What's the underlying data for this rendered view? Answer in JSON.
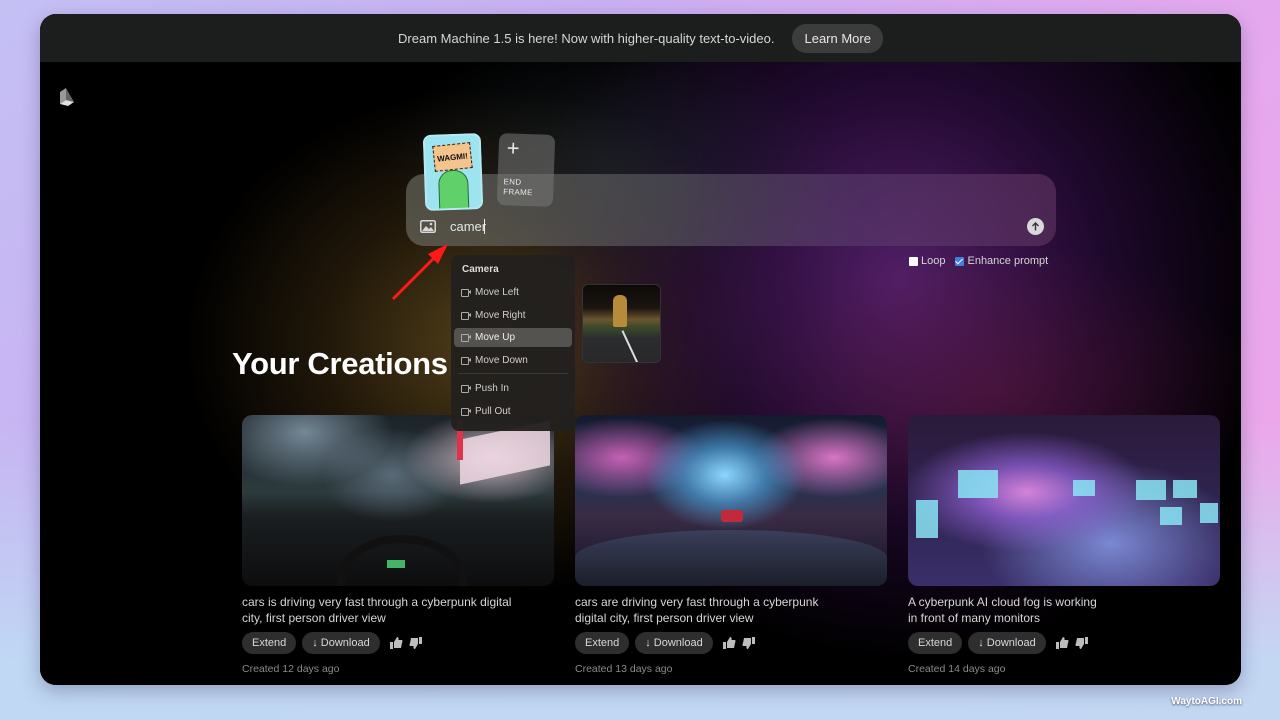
{
  "banner": {
    "message": "Dream Machine 1.5 is here! Now with higher-quality text-to-video.",
    "cta_label": "Learn More"
  },
  "app": {
    "logo_icon": "luma-cube-icon"
  },
  "frames": {
    "start_frame_text": "WAGMI!",
    "end_frame_plus": "+",
    "end_frame_label_line1": "END",
    "end_frame_label_line2": "FRAME"
  },
  "prompt": {
    "value": "camer",
    "image_icon": "image-icon",
    "send_icon": "arrow-up-icon"
  },
  "options": [
    {
      "label": "Loop",
      "checked": false
    },
    {
      "label": "Enhance prompt",
      "checked": true
    }
  ],
  "dropdown": {
    "header": "Camera",
    "items": [
      {
        "label": "Move Left",
        "icon": "camera-icon",
        "active": false
      },
      {
        "label": "Move Right",
        "icon": "camera-icon",
        "active": false
      },
      {
        "label": "Move Up",
        "icon": "camera-icon",
        "active": true
      },
      {
        "label": "Move Down",
        "icon": "camera-icon",
        "active": false
      },
      {
        "label": "Push In",
        "icon": "camera-icon",
        "active": false
      },
      {
        "label": "Pull Out",
        "icon": "camera-icon",
        "active": false
      }
    ]
  },
  "section": {
    "title": "Your Creations"
  },
  "creations": [
    {
      "caption": "cars is driving very fast through a cyberpunk digital city, first person driver view",
      "extend_label": "Extend",
      "download_label": "↓ Download",
      "created": "Created 12 days ago"
    },
    {
      "caption": "cars are driving very fast through a cyberpunk digital city, first person driver view",
      "extend_label": "Extend",
      "download_label": "↓ Download",
      "created": "Created 13 days ago"
    },
    {
      "caption": "A cyberpunk AI cloud fog is working in front of many monitors",
      "extend_label": "Extend",
      "download_label": "↓ Download",
      "created": "Created 14 days ago"
    }
  ],
  "watermark": "WaytoAGI.com",
  "colors": {
    "accent_checkbox": "#3f7fe0",
    "annotation_arrow": "#ff1a1a"
  }
}
